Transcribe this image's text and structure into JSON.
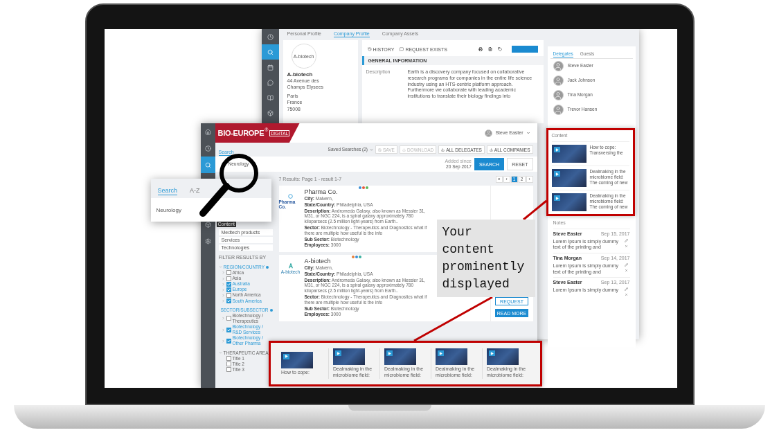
{
  "back_window": {
    "sidebar": [
      {
        "kind": "clock",
        "selected": false
      },
      {
        "kind": "search",
        "selected": true
      },
      {
        "kind": "calendar",
        "selected": false
      },
      {
        "kind": "chat",
        "selected": false
      },
      {
        "kind": "book",
        "selected": false
      },
      {
        "kind": "cube",
        "selected": false
      }
    ],
    "tabs": [
      {
        "label": "Personal Profile",
        "selected": false
      },
      {
        "label": "Company Profile",
        "selected": true
      },
      {
        "label": "Company Assets",
        "selected": false
      }
    ],
    "company": {
      "logo_text": "A-biotech",
      "name": "A-biotech",
      "address": "44 Avenue des Champs Elysees",
      "city": "Paris",
      "country": "France",
      "postcode": "75008"
    },
    "actions": [
      {
        "kind": "history",
        "label": "HISTORY"
      },
      {
        "kind": "request",
        "label": "REQUEST EXISTS"
      }
    ],
    "section_title": "GENERAL INFORMATION",
    "description_label": "Description",
    "description": "Earth is a discovery company focused on collaborative research programs for companies in the entire life science industry using an HTS-centric platform approach. Furthermore we collaborate with leading academic institutions to translate their biology findings into"
  },
  "right_panel": {
    "tabs": [
      {
        "label": "Delegates",
        "selected": true
      },
      {
        "label": "Guests",
        "selected": false
      }
    ],
    "delegates": [
      "Steve Easter",
      "Jack Johnson",
      "Tina Morgan",
      "Trevor Hansen"
    ],
    "content_title": "Content",
    "content_items": [
      "How to cope: Transversing the",
      "Dealmaking in the microbiome field: The coming of new",
      "Dealmaking in the microbiome field: The coming of new"
    ],
    "notes_title": "Notes",
    "notes": [
      {
        "author": "Steve Easter",
        "date": "Sep 15, 2017",
        "text": "Lorem Ipsum is simply dummy text of the printing and"
      },
      {
        "author": "Tina Morgan",
        "date": "Sep 14, 2017",
        "text": "Lorem Ipsum is simply dummy text of the printing and"
      },
      {
        "author": "Steve Easter",
        "date": "Sep 13, 2017",
        "text": "Lorem Ipsum is simply dummy"
      }
    ]
  },
  "front_window": {
    "sidebar_top": [
      {
        "kind": "home",
        "selected": false
      },
      {
        "kind": "clock",
        "selected": false
      },
      {
        "kind": "search",
        "selected": true
      }
    ],
    "sidebar_bottom": [
      {
        "kind": "cube",
        "selected": false
      },
      {
        "kind": "gear",
        "selected": false
      }
    ],
    "tooltip": "Content",
    "brand": {
      "name": "BIO-EUROPE",
      "mark": "®",
      "badge": "DIGITAL"
    },
    "user": "Steve Easter",
    "search_tabs": [
      {
        "label": "Search",
        "selected": true
      }
    ],
    "saved_searches": "Saved Searches (2)",
    "toolbar_buttons": [
      {
        "kind": "save",
        "label": "SAVE",
        "disabled": true
      },
      {
        "kind": "download",
        "label": "DOWNLOAD",
        "disabled": true
      },
      {
        "kind": "download",
        "label": "ALL DELEGATES",
        "disabled": false
      },
      {
        "kind": "download",
        "label": "ALL COMPANIES",
        "disabled": false
      }
    ],
    "search_value": "Neurology",
    "added_since_label": "Added since",
    "added_since": "20 Sep 2017",
    "search_button": "SEARCH",
    "reset_button": "RESET",
    "filter_options": [
      "Medtech products",
      "Services",
      "Technologies"
    ],
    "filter_title": "FILTER RESULTS BY",
    "filter_groups": [
      {
        "title": "REGION/COUNTRY",
        "active": true,
        "items": [
          {
            "label": "Africa",
            "checked": false,
            "expandable": true
          },
          {
            "label": "Asia",
            "checked": false,
            "expandable": true
          },
          {
            "label": "Australia",
            "checked": true,
            "expandable": true
          },
          {
            "label": "Europe",
            "checked": true,
            "expandable": true
          },
          {
            "label": "North America",
            "checked": false,
            "expandable": true
          },
          {
            "label": "South America",
            "checked": true,
            "expandable": true
          }
        ]
      },
      {
        "title": "SECTOR/SUBSECTOR",
        "active": true,
        "items": [
          {
            "label": "Biotechnology / Therapeutics",
            "checked": false,
            "expandable": true
          },
          {
            "label": "Biotechnology / R&D Services",
            "checked": true,
            "expandable": true
          },
          {
            "label": "Biotechnology / Other Pharma",
            "checked": true,
            "expandable": true
          }
        ]
      },
      {
        "title": "THERAPEUTIC AREA",
        "active": false,
        "items": [
          {
            "label": "Title 1",
            "checked": false,
            "expandable": false
          },
          {
            "label": "Title 2",
            "checked": false,
            "expandable": false
          },
          {
            "label": "Title 3",
            "checked": false,
            "expandable": false
          }
        ]
      }
    ],
    "results_summary": "7 Results: Page 1 - result 1-7",
    "pagination": [
      {
        "label": "«",
        "selected": false
      },
      {
        "label": "‹",
        "selected": false
      },
      {
        "label": "1",
        "selected": true
      },
      {
        "label": "2",
        "selected": false
      },
      {
        "label": "›",
        "selected": false
      }
    ],
    "results": [
      {
        "kind": "pharma",
        "logo_text": "Pharma Co.",
        "name": "Pharma Co.",
        "dots": [
          {
            "color": "#3b8fd6"
          },
          {
            "color": "#e8583a"
          },
          {
            "color": "#5cb85c"
          }
        ],
        "fields": [
          "**City:** Malvern,",
          "**State/Country:** Philadelphia, USA",
          "**Description:** Andromeda Galaxy, also known as Messier 31, M31, or NGC 224, is a spiral galaxy approximately 780 kiloparsecs (2.5 million light-years) from Earth..",
          "**Sector:** Biotechnology - Therapeutics and Diagnostics what if there are multiple how useful is the info",
          "**Sub Sector:** Biotechnology",
          "**Employees:** 3000"
        ]
      },
      {
        "kind": "biotech",
        "logo_text": "A-biotech",
        "name": "A-biotech",
        "dots": [
          {
            "color": "#e8803a"
          },
          {
            "color": "#3b8fd6"
          },
          {
            "color": "#3bb0a0"
          }
        ],
        "fields": [
          "**City:** Malvern,",
          "**State/Country:** Philadelphia, USA",
          "**Description:** Andromeda Galaxy, also known as Messier 31, M31, or NGC 224, is a spiral galaxy approximately 780 kiloparsecs (2.5 million light-years) from Earth..",
          "**Sector:** Biotechnology - Therapeutics and Diagnostics what if there are multiple how useful is the info",
          "**Sub Sector:** Biotechnology",
          "**Employees:** 3000"
        ],
        "buttons": [
          {
            "kind": "outline",
            "label": "REQUEST"
          },
          {
            "kind": "filled",
            "label": "READ MORE"
          }
        ]
      }
    ]
  },
  "popup": {
    "tabs": [
      {
        "label": "Search",
        "selected": true
      },
      {
        "label": "A-Z",
        "selected": false
      }
    ],
    "value": "Neurology"
  },
  "callout": "Your content prominently displayed",
  "content_strip": [
    "How to cope:",
    "Dealmaking in the microbiome field:",
    "Dealmaking in the microbiome field:",
    "Dealmaking in the microbiome field:",
    "Dealmaking in the microbiome field:"
  ]
}
